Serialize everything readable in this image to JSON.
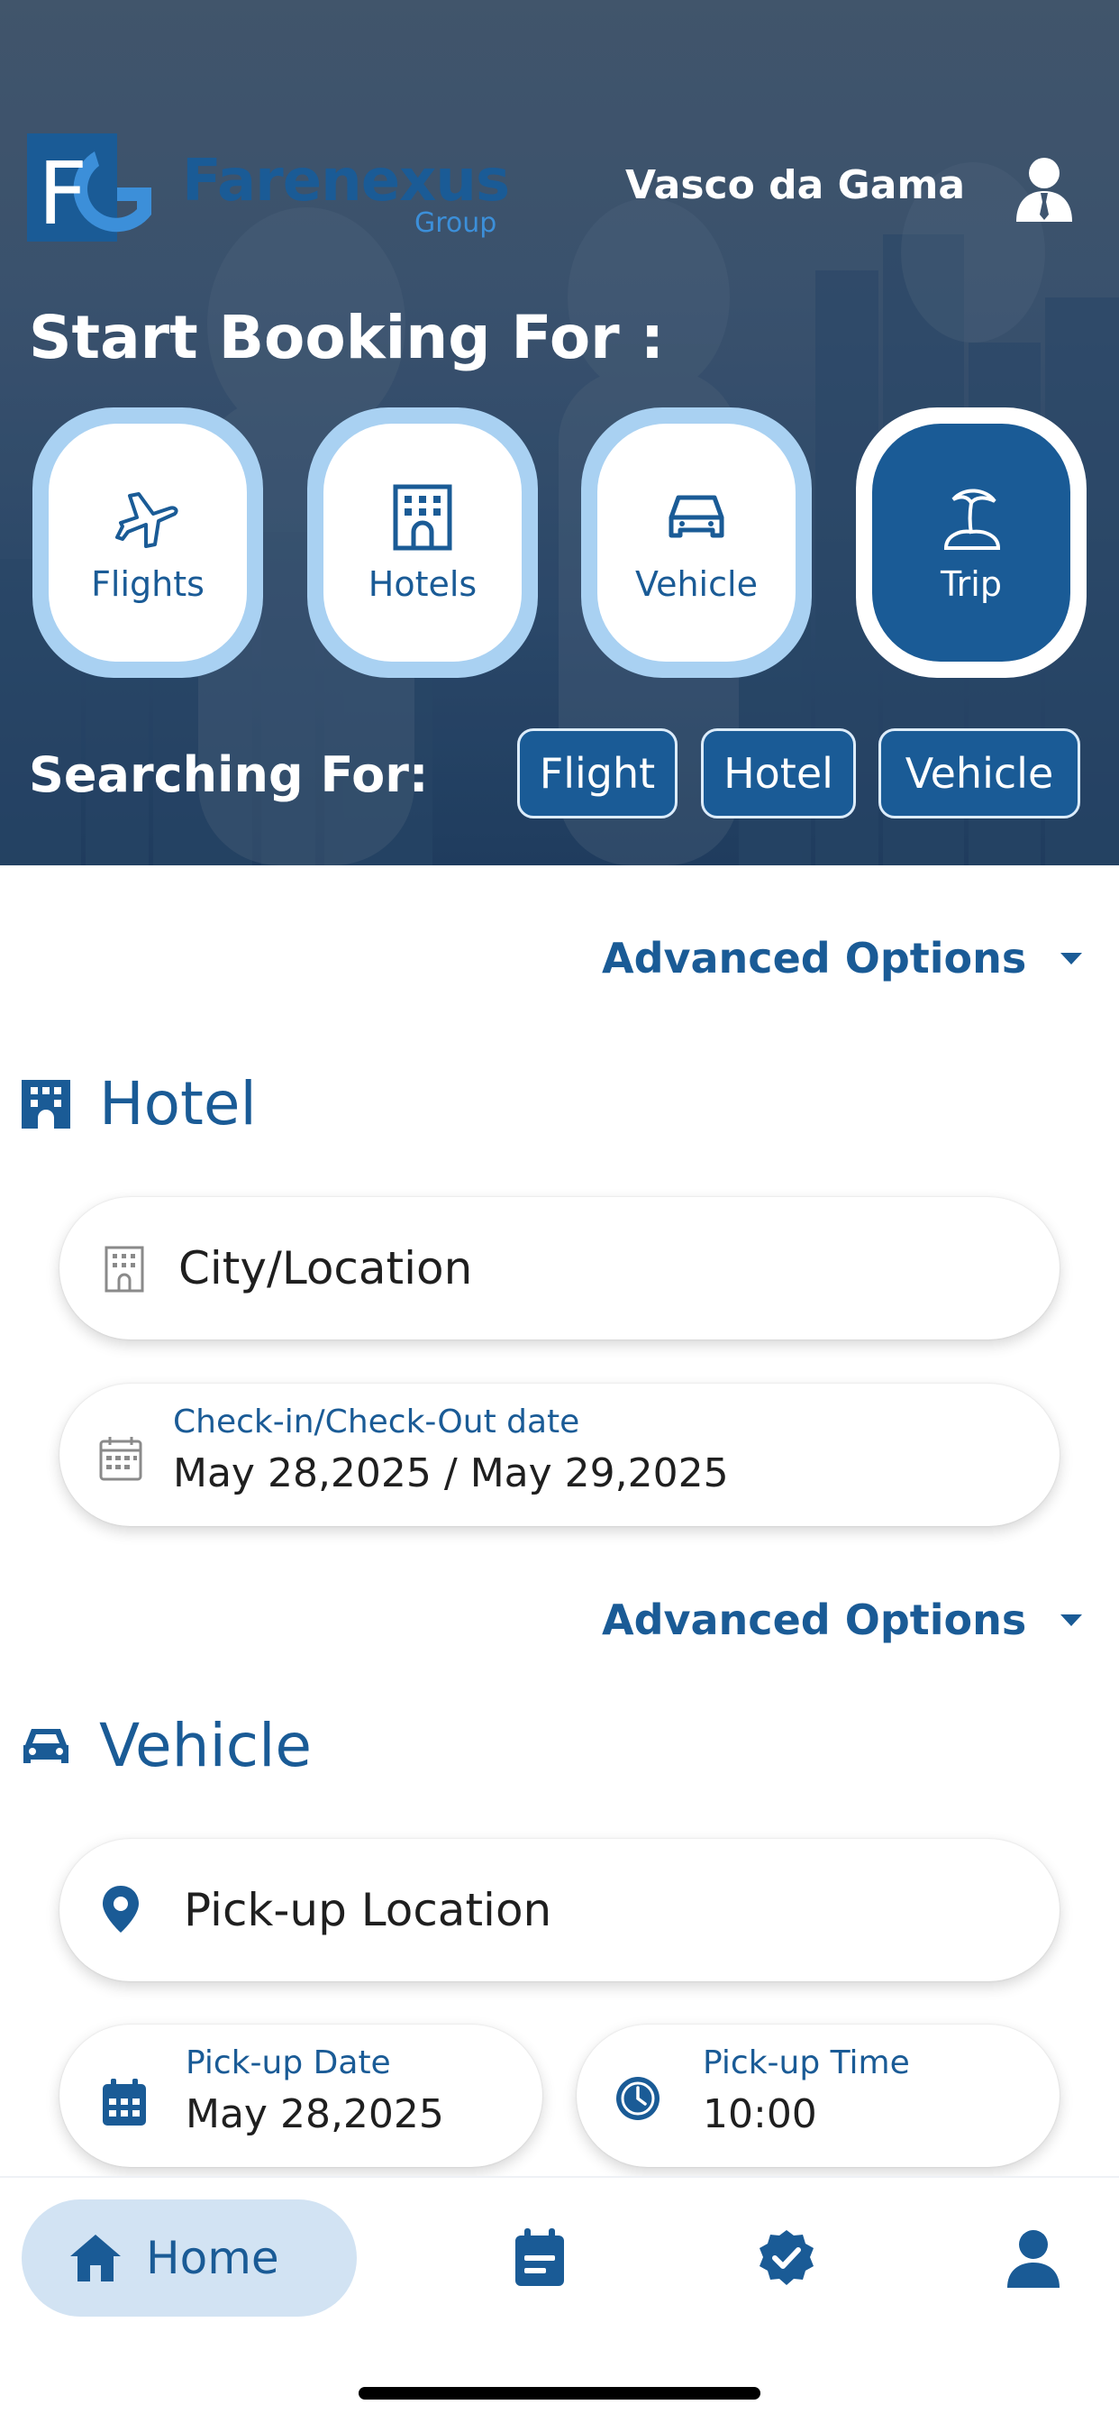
{
  "header": {
    "logo": {
      "letters": "FG",
      "word": "Farenexus",
      "sub": "Group"
    },
    "user_name": "Vasco da Gama",
    "title": "Start Booking For :"
  },
  "categories": [
    {
      "label": "Flights",
      "icon": "plane-icon",
      "active": false
    },
    {
      "label": "Hotels",
      "icon": "building-icon",
      "active": false
    },
    {
      "label": "Vehicle",
      "icon": "car-icon",
      "active": false
    },
    {
      "label": "Trip",
      "icon": "palm-island-icon",
      "active": true
    }
  ],
  "searching": {
    "label": "Searching For:",
    "chips": [
      "Flight",
      "Hotel",
      "Vehicle"
    ]
  },
  "advanced_options": "Advanced Options",
  "hotel": {
    "title": "Hotel",
    "city_placeholder": "City/Location",
    "dates_label": "Check-in/Check-Out date",
    "dates_value": "May 28,2025 / May 29,2025"
  },
  "vehicle": {
    "title": "Vehicle",
    "pickup_location_placeholder": "Pick-up Location",
    "pickup_date_label": "Pick-up Date",
    "pickup_date_value": "May 28,2025",
    "pickup_time_label": "Pick-up Time",
    "pickup_time_value": "10:00"
  },
  "nav": {
    "home_label": "Home",
    "items": [
      "home-icon",
      "calendar-icon",
      "verified-badge-icon",
      "profile-icon"
    ]
  },
  "colors": {
    "brand": "#1a5b96",
    "chip_ring": "#a9d1f2",
    "nav_active": "#d2e3f3"
  }
}
